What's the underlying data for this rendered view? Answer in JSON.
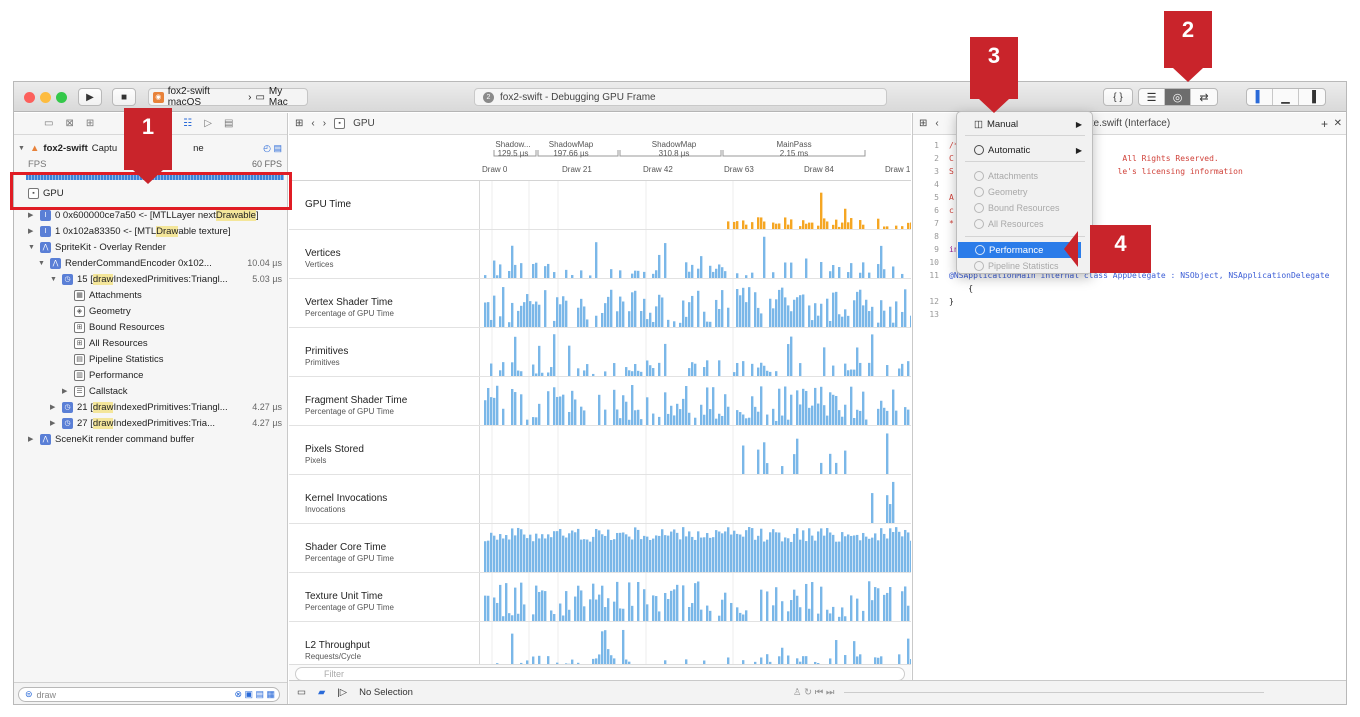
{
  "toolbar": {
    "scheme": "fox2-swift macOS",
    "destination": "My Mac",
    "activity": "fox2-swift - Debugging GPU Frame",
    "editor_code_label": "{ }"
  },
  "navigator": {
    "search_placeholder": "draw",
    "rows": [
      {
        "label_pre": "fox2-swift",
        "label_rest": " Captu",
        "label_post": "ne"
      },
      {
        "label": "FPS",
        "time": "60 FPS"
      },
      {
        "label": "GPU"
      },
      {
        "label_pre": "0 0x600000ce7a50 <- [MTLLayer next",
        "highlight": "Drawable",
        "label_post": "]"
      },
      {
        "label_pre": "1 0x102a83350 <- [MTL",
        "highlight": "Draw",
        "label_post": "able texture]"
      },
      {
        "label": "SpriteKit - Overlay Render"
      },
      {
        "label": "RenderCommandEncoder 0x102...",
        "time": "10.04 µs"
      },
      {
        "label_pre": "15 [",
        "highlight": "draw",
        "label_post": "IndexedPrimitives:Triangl...",
        "time": "5.03 µs"
      },
      {
        "label": "Attachments"
      },
      {
        "label": "Geometry"
      },
      {
        "label": "Bound Resources"
      },
      {
        "label": "All Resources"
      },
      {
        "label": "Pipeline Statistics"
      },
      {
        "label": "Performance"
      },
      {
        "label": "Callstack"
      },
      {
        "label_pre": "21 [",
        "highlight": "draw",
        "label_post": "IndexedPrimitives:Triangl...",
        "time": "4.27 µs"
      },
      {
        "label_pre": "27 [",
        "highlight": "draw",
        "label_post": "IndexedPrimitives:Tria...",
        "time": "4.27 µs"
      },
      {
        "label": "SceneKit render command buffer"
      }
    ]
  },
  "center": {
    "jump_label": "GPU",
    "passes": [
      {
        "name": "Shadow...",
        "time": "129.5 µs"
      },
      {
        "name": "ShadowMap",
        "time": "197.66 µs"
      },
      {
        "name": "ShadowMap",
        "time": "310.8 µs"
      },
      {
        "name": "MainPass",
        "time": "2.15 ms"
      }
    ],
    "draws": [
      "Draw 0",
      "Draw 21",
      "Draw 42",
      "Draw 63",
      "Draw 84",
      "Draw 1"
    ],
    "rows": [
      {
        "title": "GPU Time",
        "subtitle": "",
        "color": "#f5a623"
      },
      {
        "title": "Vertices",
        "subtitle": "Vertices",
        "color": "#7ab7e8"
      },
      {
        "title": "Vertex Shader Time",
        "subtitle": "Percentage of GPU Time",
        "color": "#7ab7e8"
      },
      {
        "title": "Primitives",
        "subtitle": "Primitives",
        "color": "#7ab7e8"
      },
      {
        "title": "Fragment Shader Time",
        "subtitle": "Percentage of GPU Time",
        "color": "#7ab7e8"
      },
      {
        "title": "Pixels Stored",
        "subtitle": "Pixels",
        "color": "#7ab7e8"
      },
      {
        "title": "Kernel Invocations",
        "subtitle": "Invocations",
        "color": "#7ab7e8"
      },
      {
        "title": "Shader Core Time",
        "subtitle": "Percentage of GPU Time",
        "color": "#7ab7e8"
      },
      {
        "title": "Texture Unit Time",
        "subtitle": "Percentage of GPU Time",
        "color": "#7ab7e8"
      },
      {
        "title": "L2 Throughput",
        "subtitle": "Requests/Cycle",
        "color": "#7ab7e8"
      }
    ],
    "filter_placeholder": "Filter"
  },
  "debug_bar": {
    "status": "No Selection"
  },
  "editor": {
    "filename": "te.swift (Interface)",
    "lines": [
      {
        "n": "1",
        "t": "/*",
        "c": "comment"
      },
      {
        "n": "2",
        "t": "C                                   All Rights Reserved.",
        "c": "comment"
      },
      {
        "n": "3",
        "t": "S                                  le's licensing information",
        "c": "comment"
      },
      {
        "n": "4",
        "t": "",
        "c": "comment"
      },
      {
        "n": "5",
        "t": "A",
        "c": "comment"
      },
      {
        "n": "6",
        "t": "c",
        "c": "comment"
      },
      {
        "n": "7",
        "t": "*",
        "c": "comment"
      },
      {
        "n": "8",
        "t": "",
        "c": "plain"
      },
      {
        "n": "9",
        "t": "in",
        "c": "keyword"
      },
      {
        "n": "10",
        "t": "",
        "c": "plain"
      },
      {
        "n": "11",
        "t": "@NSApplicationMain internal class AppDelegate : NSObject, NSApplicationDelegate",
        "c": "plain"
      },
      {
        "n": "",
        "t": "    {",
        "c": "plain"
      },
      {
        "n": "12",
        "t": "}",
        "c": "plain"
      },
      {
        "n": "13",
        "t": "",
        "c": "plain"
      }
    ]
  },
  "menu": {
    "items": [
      {
        "label": "Manual",
        "has_sub": true,
        "enabled": true
      },
      {
        "label": "Automatic",
        "has_sub": true,
        "enabled": true
      },
      {
        "label": "Attachments",
        "enabled": false
      },
      {
        "label": "Geometry",
        "enabled": false
      },
      {
        "label": "Bound Resources",
        "enabled": false
      },
      {
        "label": "All Resources",
        "enabled": false
      },
      {
        "label": "Performance",
        "enabled": true,
        "selected": true
      },
      {
        "label": "Pipeline Statistics",
        "enabled": false
      }
    ]
  },
  "callouts": [
    "1",
    "2",
    "3",
    "4"
  ]
}
